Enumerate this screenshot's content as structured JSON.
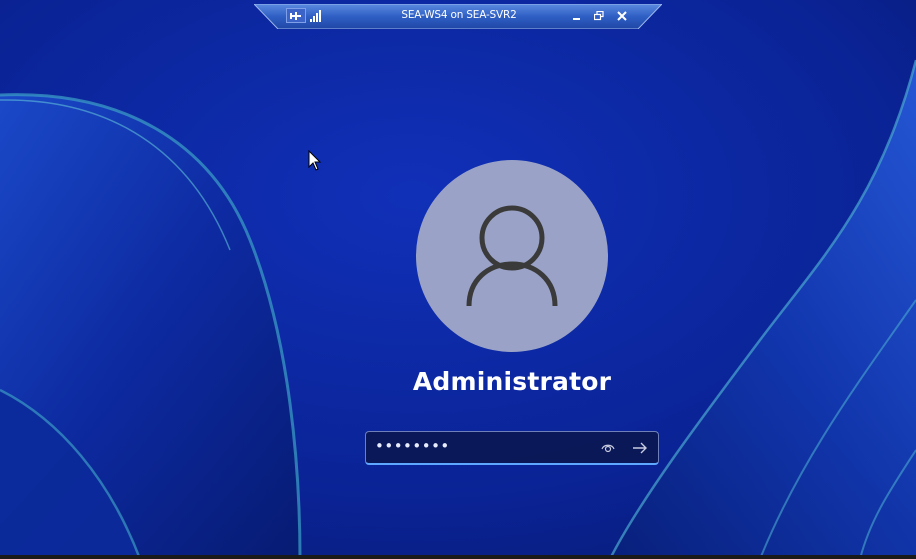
{
  "window": {
    "connection_title": "SEA-WS4 on SEA-SVR2"
  },
  "connection_bar": {
    "pin_icon": "pin-icon",
    "signal_icon": "signal-strength-icon",
    "minimize_icon": "minimize-icon",
    "restore_icon": "restore-icon",
    "close_icon": "close-icon"
  },
  "login": {
    "avatar_icon": "user-icon",
    "username": "Administrator",
    "password_value": "••••••••",
    "reveal_icon": "eye-icon",
    "submit_icon": "arrow-right-icon"
  },
  "colors": {
    "background": "#0a1f8c",
    "avatar": "#9aa3c7",
    "connection_bar": "#2f5fc4",
    "field_focus_underline": "#5fa8ff"
  }
}
